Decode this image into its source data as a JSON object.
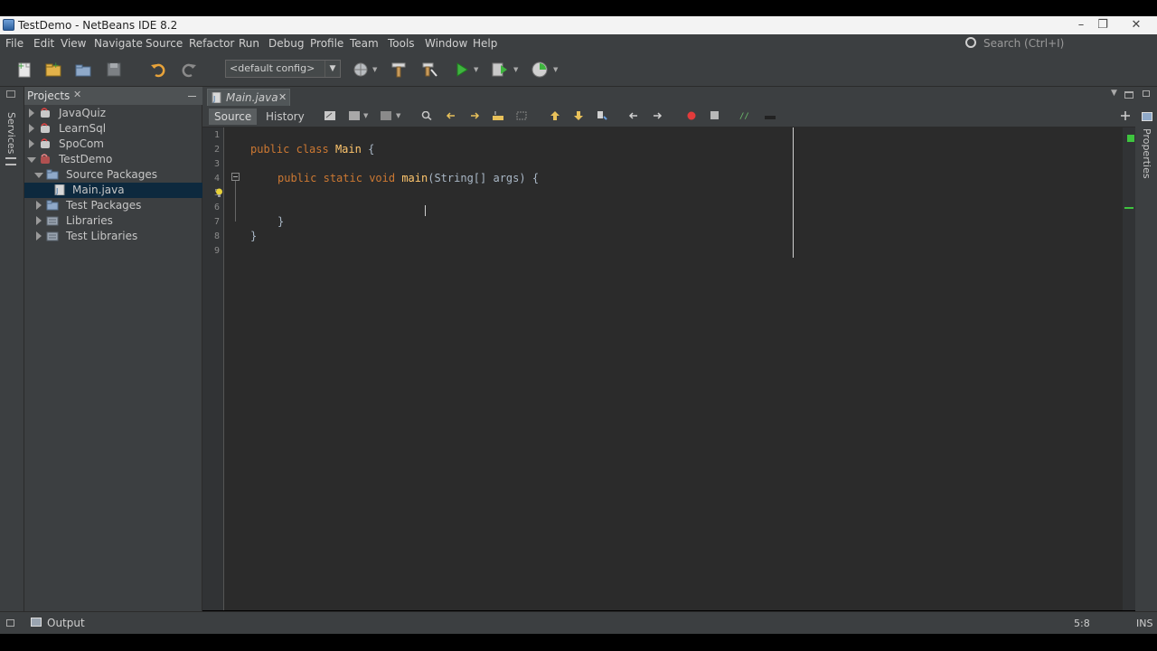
{
  "window": {
    "title": "TestDemo - NetBeans IDE 8.2"
  },
  "menu": [
    "File",
    "Edit",
    "View",
    "Navigate",
    "Source",
    "Refactor",
    "Run",
    "Debug",
    "Profile",
    "Team",
    "Tools",
    "Window",
    "Help"
  ],
  "search": {
    "placeholder": "Search (Ctrl+I)"
  },
  "toolbar": {
    "config": "<default config>"
  },
  "projects_panel": {
    "title": "Projects",
    "items": [
      {
        "label": "JavaQuiz",
        "state": "collapsed",
        "level": 0
      },
      {
        "label": "LearnSql",
        "state": "collapsed",
        "level": 0
      },
      {
        "label": "SpoCom",
        "state": "collapsed",
        "level": 0
      },
      {
        "label": "TestDemo",
        "state": "expanded",
        "level": 0
      },
      {
        "label": "Source Packages",
        "state": "expanded",
        "level": 1
      },
      {
        "label": "Main.java",
        "state": "leaf",
        "level": 2,
        "selected": true
      },
      {
        "label": "Test Packages",
        "state": "collapsed",
        "level": 1
      },
      {
        "label": "Libraries",
        "state": "collapsed",
        "level": 1
      },
      {
        "label": "Test Libraries",
        "state": "collapsed",
        "level": 1
      }
    ]
  },
  "side_tabs": {
    "left": "Services",
    "right": "Properties"
  },
  "editor": {
    "tab": "Main.java",
    "views": [
      "Source",
      "History"
    ],
    "line_numbers": [
      "1",
      "2",
      "3",
      "4",
      "5",
      "6",
      "7",
      "8",
      "9"
    ],
    "code": {
      "l2_kw1": "public",
      "l2_kw2": "class",
      "l2_name": "Main",
      "l2_rest": " {",
      "l4_kw1": "public",
      "l4_kw2": "static",
      "l4_kw3": "void",
      "l4_name": "main",
      "l4_rest": "(String[] args) {",
      "l7": "}",
      "l8": "}"
    }
  },
  "status": {
    "output": "Output",
    "position": "5:8",
    "mode": "INS"
  },
  "colors": {
    "background": "#2b2b2b",
    "keyword": "#cc7832",
    "method": "#ffc66d",
    "text": "#a9b7c6"
  }
}
